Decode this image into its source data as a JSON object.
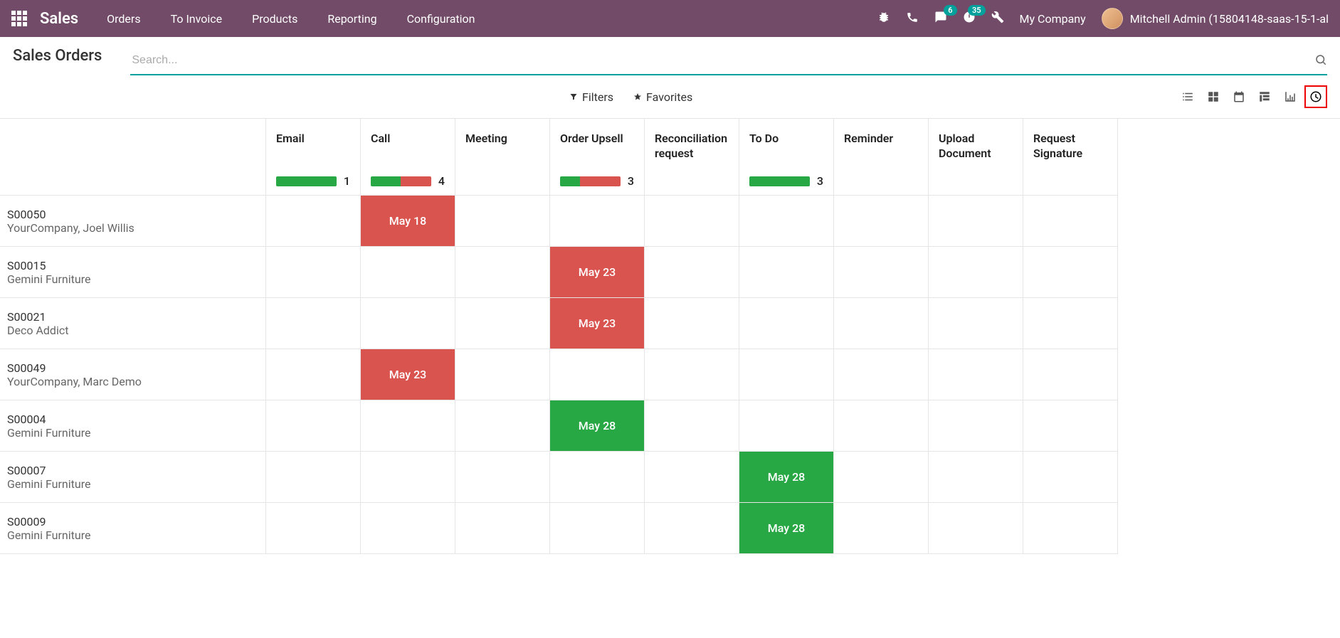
{
  "nav": {
    "app_name": "Sales",
    "items": [
      "Orders",
      "To Invoice",
      "Products",
      "Reporting",
      "Configuration"
    ],
    "messages_badge": "6",
    "activities_badge": "35",
    "company": "My Company",
    "user": "Mitchell Admin (15804148-saas-15-1-al"
  },
  "page": {
    "title": "Sales Orders",
    "search_placeholder": "Search...",
    "filters_label": "Filters",
    "favorites_label": "Favorites"
  },
  "columns": [
    {
      "title": "Email",
      "count": "1",
      "green": 100,
      "red": 0
    },
    {
      "title": "Call",
      "count": "4",
      "green": 50,
      "red": 50
    },
    {
      "title": "Meeting",
      "count": null
    },
    {
      "title": "Order Upsell",
      "count": "3",
      "green": 33,
      "red": 67
    },
    {
      "title": "Reconciliation request",
      "count": null
    },
    {
      "title": "To Do",
      "count": "3",
      "green": 100,
      "red": 0
    },
    {
      "title": "Reminder",
      "count": null
    },
    {
      "title": "Upload Document",
      "count": null
    },
    {
      "title": "Request Signature",
      "count": null
    }
  ],
  "rows": [
    {
      "id": "S00050",
      "sub": "YourCompany, Joel Willis",
      "cells": {
        "1": {
          "label": "May 18",
          "state": "overdue"
        }
      }
    },
    {
      "id": "S00015",
      "sub": "Gemini Furniture",
      "cells": {
        "3": {
          "label": "May 23",
          "state": "overdue"
        }
      }
    },
    {
      "id": "S00021",
      "sub": "Deco Addict",
      "cells": {
        "3": {
          "label": "May 23",
          "state": "overdue"
        }
      }
    },
    {
      "id": "S00049",
      "sub": "YourCompany, Marc Demo",
      "cells": {
        "1": {
          "label": "May 23",
          "state": "overdue"
        }
      }
    },
    {
      "id": "S00004",
      "sub": "Gemini Furniture",
      "cells": {
        "3": {
          "label": "May 28",
          "state": "planned"
        }
      }
    },
    {
      "id": "S00007",
      "sub": "Gemini Furniture",
      "cells": {
        "5": {
          "label": "May 28",
          "state": "planned"
        }
      }
    },
    {
      "id": "S00009",
      "sub": "Gemini Furniture",
      "cells": {
        "5": {
          "label": "May 28",
          "state": "planned"
        }
      }
    }
  ]
}
